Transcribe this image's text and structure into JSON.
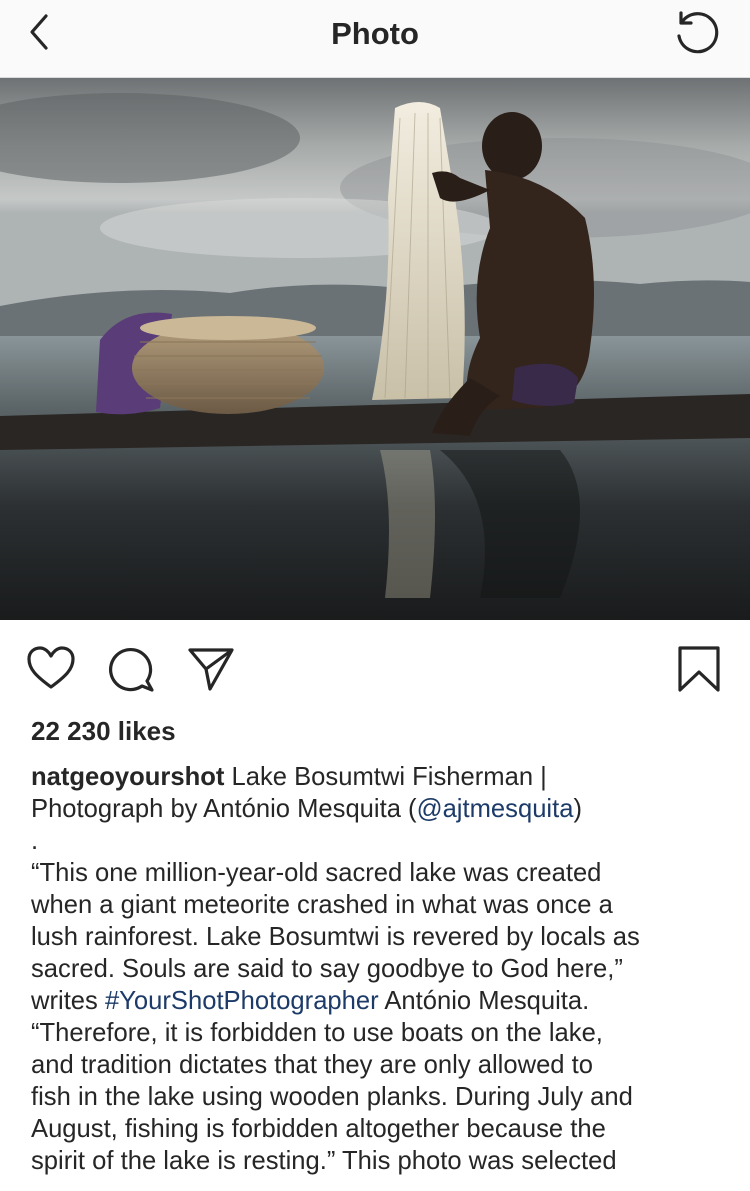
{
  "header": {
    "title": "Photo",
    "back_icon": "chevron-left-icon",
    "refresh_icon": "refresh-icon"
  },
  "photo": {
    "subject": "fisherman-with-net-photo"
  },
  "actions": {
    "like_icon": "heart-icon",
    "comment_icon": "comment-icon",
    "share_icon": "send-icon",
    "save_icon": "bookmark-icon"
  },
  "post": {
    "likes": "22 230 likes",
    "username": "natgeoyourshot",
    "caption_l1_rest": " Lake Bosumtwi Fisherman |",
    "caption_l2_a": "Photograph by António Mesquita (",
    "mention": "@ajtmesquita",
    "caption_l2_b": ")",
    "dot": ".",
    "l4": "“This one million-year-old sacred lake was created",
    "l5": "when a giant meteorite crashed in what was once a",
    "l6": "lush rainforest. Lake Bosumtwi is revered by locals as",
    "l7": "sacred. Souls are said to say goodbye to God here,”",
    "l8_a": "writes ",
    "hashtag": "#YourShotPhotographer",
    "l8_b": " António Mesquita.",
    "l9": "“Therefore, it is forbidden to use boats on the lake,",
    "l10": "and tradition dictates that they are only allowed to",
    "l11": "fish in the lake using wooden planks. During July and",
    "l12": "August, fishing is forbidden altogether because the",
    "l13": "spirit of the lake is resting.” This photo was selected"
  },
  "colors": {
    "header_bg": "#fafafa",
    "text": "#262626",
    "link": "#1d3b68",
    "divider": "#dbdbdb"
  }
}
